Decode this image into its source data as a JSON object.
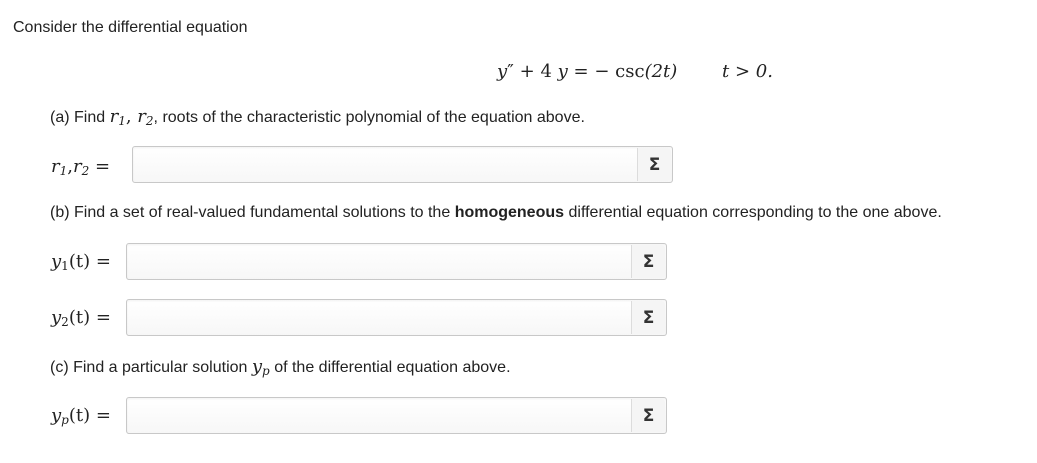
{
  "intro": "Consider the differential equation",
  "equation": {
    "y": "y",
    "prime": "″",
    "plus": "+ 4",
    "y2": "y",
    "equals": "= −",
    "csc": "csc",
    "arg": "(2t)",
    "condition": "t > 0."
  },
  "part_a": {
    "prefix": "(a) Find",
    "r1": "r",
    "r1_sub": "1",
    "comma": ",",
    "r2": "r",
    "r2_sub": "2",
    "suffix": ", roots of the characteristic polynomial of the equation above.",
    "label_r1": "r",
    "label_r1_sub": "1",
    "label_comma": ",",
    "label_r2": "r",
    "label_r2_sub": "2",
    "label_eq": "=",
    "input_value": ""
  },
  "part_b": {
    "prefix": "(b) Find a set of real-valued fundamental solutions to the",
    "bold": "homogeneous",
    "suffix": "differential equation corresponding to the one above.",
    "y1_label": "y",
    "y1_sub": "1",
    "y1_arg": "(t)",
    "y1_eq": "=",
    "y1_value": "",
    "y2_label": "y",
    "y2_sub": "2",
    "y2_arg": "(t)",
    "y2_eq": "=",
    "y2_value": ""
  },
  "part_c": {
    "prefix": "(c) Find a particular solution",
    "yp": "y",
    "yp_sub": "p",
    "suffix": "of the differential equation above.",
    "yp_label": "y",
    "yp_label_sub": "p",
    "yp_arg": "(t)",
    "yp_eq": "=",
    "yp_value": ""
  },
  "equation_editor_symbol": "Σ",
  "equation_editor_icon": "sigma-icon"
}
